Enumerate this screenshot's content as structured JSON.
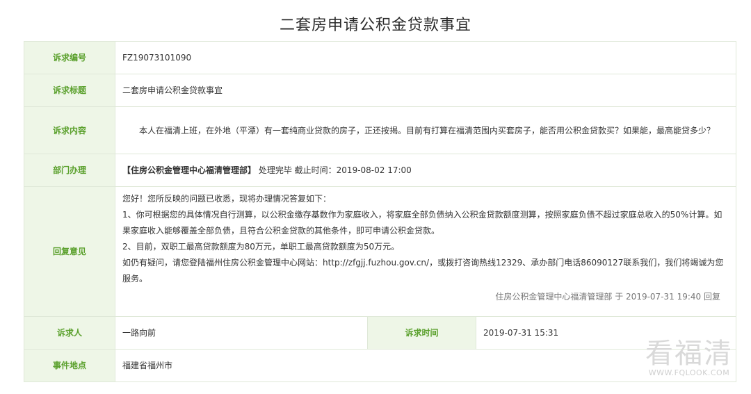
{
  "page": {
    "title": "二套房申请公积金贷款事宜"
  },
  "rows": {
    "number": {
      "label": "诉求编号",
      "value": "FZ19073101090"
    },
    "subject": {
      "label": "诉求标题",
      "value": "二套房申请公积金贷款事宜"
    },
    "content": {
      "label": "诉求内容",
      "value": "本人在福清上班，在外地（平潭）有一套纯商业贷款的房子，正还按揭。目前有打算在福清范围内买套房子，能否用公积金贷款买？如果能，最高能贷多少？"
    },
    "department": {
      "label": "部门办理",
      "dept": "【住房公积金管理中心福清管理部】",
      "status": "处理完毕 截止时间：2019-08-02 17:00"
    },
    "reply": {
      "label": "回复意见",
      "lines": [
        "您好！您所反映的问题已收悉，现将办理情况答复如下：",
        "1、你可根据您的具体情况自行测算，以公积金缴存基数作为家庭收入，将家庭全部负债纳入公积金贷款额度测算，按照家庭负债不超过家庭总收入的50%计算。如果家庭收入能够覆盖全部负债，且符合公积金贷款的其他条件，即可申请公积金贷款。",
        "2、目前，双职工最高贷款额度为80万元，单职工最高贷款额度为50万元。",
        "如仍有疑问，请您登陆福州住房公积金管理中心网站：http://zfgjj.fuzhou.gov.cn/，或拨打咨询热线12329、承办部门电话86090127联系我们，我们将竭诚为您服务。"
      ],
      "signature": "住房公积金管理中心福清管理部 于 2019-07-31 19:40 回复"
    },
    "petitioner": {
      "label": "诉求人",
      "value": "一路向前"
    },
    "time": {
      "label": "诉求时间",
      "value": "2019-07-31 15:31"
    },
    "location": {
      "label": "事件地点",
      "value": "福建省福州市"
    }
  },
  "watermark": {
    "text": "看福清",
    "url": "WWW.FQLOOK.COM"
  },
  "colors": {
    "label_bg": "#eef6e7",
    "label_text": "#5aa02c",
    "border": "#dfe8d8"
  }
}
